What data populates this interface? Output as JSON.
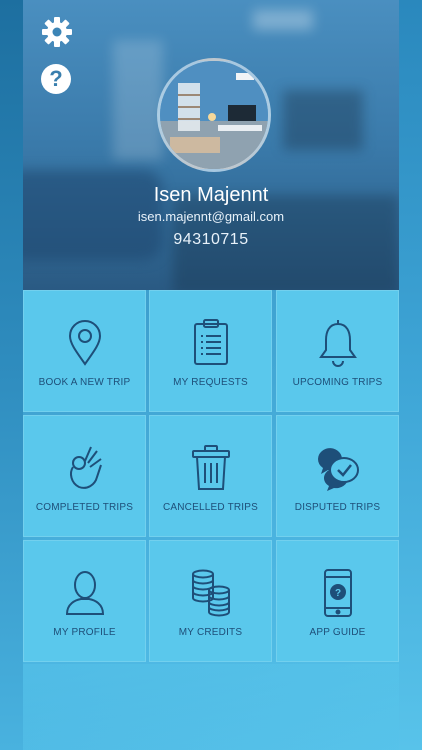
{
  "profile": {
    "name": "Isen Majennt",
    "email": "isen.majennt@gmail.com",
    "phone": "94310715"
  },
  "header": {
    "settings_icon": "gear-icon",
    "help_icon": "question-icon",
    "help_glyph": "?"
  },
  "menu": [
    {
      "label": "BOOK A NEW TRIP",
      "icon": "location-pin-icon"
    },
    {
      "label": "MY REQUESTS",
      "icon": "clipboard-icon"
    },
    {
      "label": "UPCOMING TRIPS",
      "icon": "bell-icon"
    },
    {
      "label": "COMPLETED TRIPS",
      "icon": "ok-hand-icon"
    },
    {
      "label": "CANCELLED TRIPS",
      "icon": "trash-icon"
    },
    {
      "label": "DISPUTED TRIPS",
      "icon": "chat-bubbles-icon"
    },
    {
      "label": "MY PROFILE",
      "icon": "user-icon"
    },
    {
      "label": "MY CREDITS",
      "icon": "coins-icon"
    },
    {
      "label": "APP GUIDE",
      "icon": "phone-help-icon"
    }
  ],
  "colors": {
    "tile": "#5ac8ec",
    "tile_text": "#1e4f79",
    "icon_stroke": "#1e4f79"
  }
}
